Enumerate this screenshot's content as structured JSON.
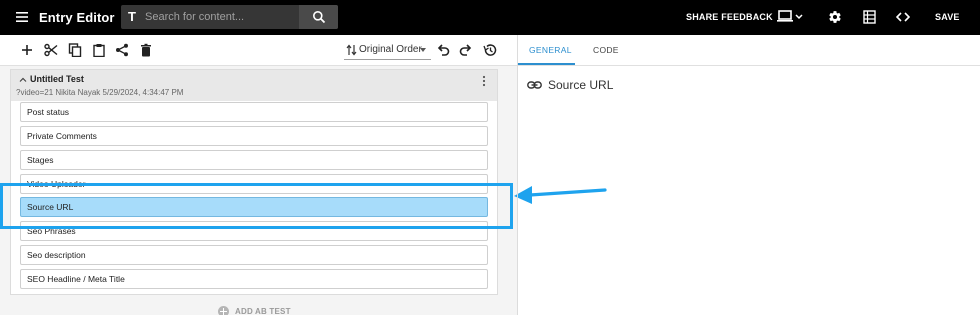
{
  "header": {
    "app_title": "Entry Editor",
    "search_placeholder": "Search for content...",
    "share_feedback": "SHARE FEEDBACK",
    "save": "SAVE"
  },
  "toolbar": {
    "order_label": "Original Order"
  },
  "entry": {
    "title": "Untitled Test",
    "meta": "?video=21 Nikita Nayak 5/29/2024, 4:34:47 PM",
    "fields": [
      "Post status",
      "Private Comments",
      "Stages",
      "Video Uploader",
      "Source URL",
      "Seo Phrases",
      "Seo description",
      "SEO Headline / Meta Title"
    ],
    "selected_field": "Source URL",
    "add_ab_test": "ADD AB TEST"
  },
  "right_panel": {
    "tabs": [
      "GENERAL",
      "CODE"
    ],
    "active_tab": "GENERAL",
    "section_title": "Source URL"
  },
  "colors": {
    "accent": "#2d8fcf",
    "selected_field_bg": "#a7dcfa",
    "annotation": "#1ea3ee",
    "topbar_bg": "#000000"
  }
}
